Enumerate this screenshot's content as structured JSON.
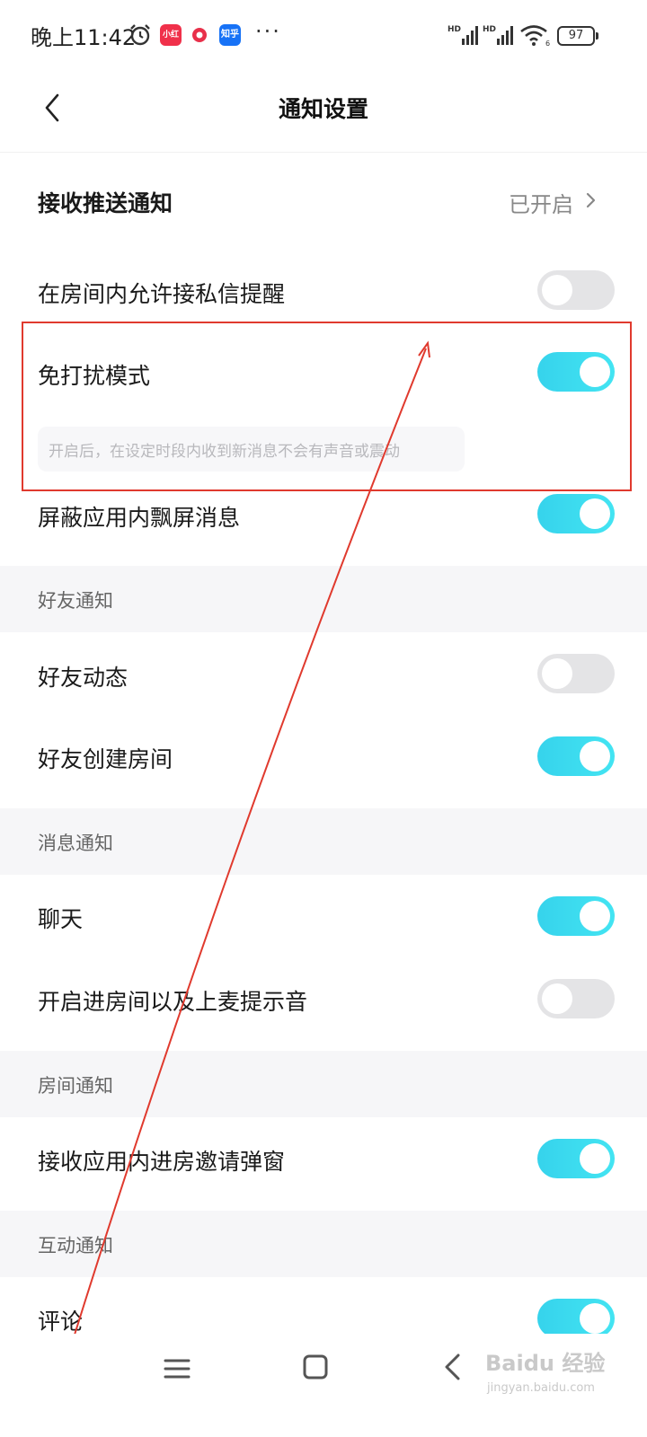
{
  "status_bar": {
    "time": "晚上11:42",
    "app_badges": [
      "小红书",
      "",
      "知乎"
    ],
    "more": "···",
    "signal_label": "HD",
    "wifi_sub": "6",
    "battery": "97"
  },
  "header": {
    "title": "通知设置"
  },
  "settings": {
    "push": {
      "label": "接收推送通知",
      "value": "已开启"
    },
    "room_private_msg": {
      "label": "在房间内允许接私信提醒",
      "on": false
    },
    "dnd": {
      "label": "免打扰模式",
      "on": true,
      "hint": "开启后，在设定时段内收到新消息不会有声音或震动"
    },
    "block_float": {
      "label": "屏蔽应用内飘屏消息",
      "on": true
    }
  },
  "sections": {
    "friends": {
      "title": "好友通知",
      "items": [
        {
          "label": "好友动态",
          "on": false
        },
        {
          "label": "好友创建房间",
          "on": true
        }
      ]
    },
    "messages": {
      "title": "消息通知",
      "items": [
        {
          "label": "聊天",
          "on": true
        },
        {
          "label": "开启进房间以及上麦提示音",
          "on": false
        }
      ]
    },
    "rooms": {
      "title": "房间通知",
      "items": [
        {
          "label": "接收应用内进房邀请弹窗",
          "on": true
        }
      ]
    },
    "interaction": {
      "title": "互动通知",
      "items": [
        {
          "label": "评论",
          "on": true
        }
      ]
    }
  },
  "watermark": {
    "text": "Baidu 经验",
    "sub": "jingyan.baidu.com"
  },
  "colors": {
    "toggle_on": "#36d3ec",
    "toggle_off": "#e4e4e6",
    "annotation": "#e03a2e",
    "section_bg": "#f6f6f8"
  }
}
